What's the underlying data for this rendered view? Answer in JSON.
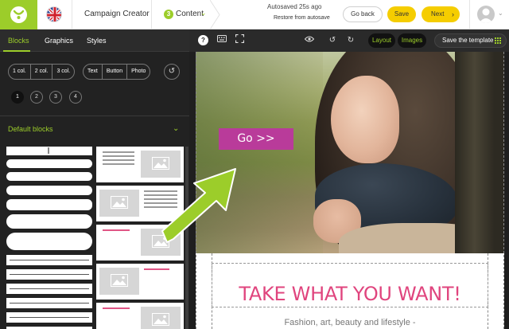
{
  "header": {
    "app_title": "Campaign Creator",
    "step_number": "3",
    "step_label": "Content",
    "autosave_status": "Autosaved 25s ago",
    "restore_label": "Restore from autosave",
    "go_back_label": "Go back",
    "save_label": "Save",
    "next_label": "Next"
  },
  "left_panel": {
    "tabs": [
      "Blocks",
      "Graphics",
      "Styles"
    ],
    "active_tab": "Blocks",
    "column_options": [
      "1 col.",
      "2 col.",
      "3 col."
    ],
    "element_options": [
      "Text",
      "Button",
      "Photo"
    ],
    "pages": [
      "1",
      "2",
      "3",
      "4"
    ],
    "active_page": "1",
    "section_title": "Default blocks"
  },
  "toolbar": {
    "layout_label": "Layout",
    "images_label": "Images",
    "save_template_label": "Save the template"
  },
  "canvas": {
    "hero_button_label": "Go >>",
    "headline": "TAKE WHAT YOU WANT!",
    "subline": "Fashion, art, beauty and lifestyle -"
  },
  "colors": {
    "brand_green": "#9ccd2a",
    "primary_yellow": "#f5cd00",
    "hero_button": "#b93b9a",
    "headline_pink": "#e0457e"
  }
}
